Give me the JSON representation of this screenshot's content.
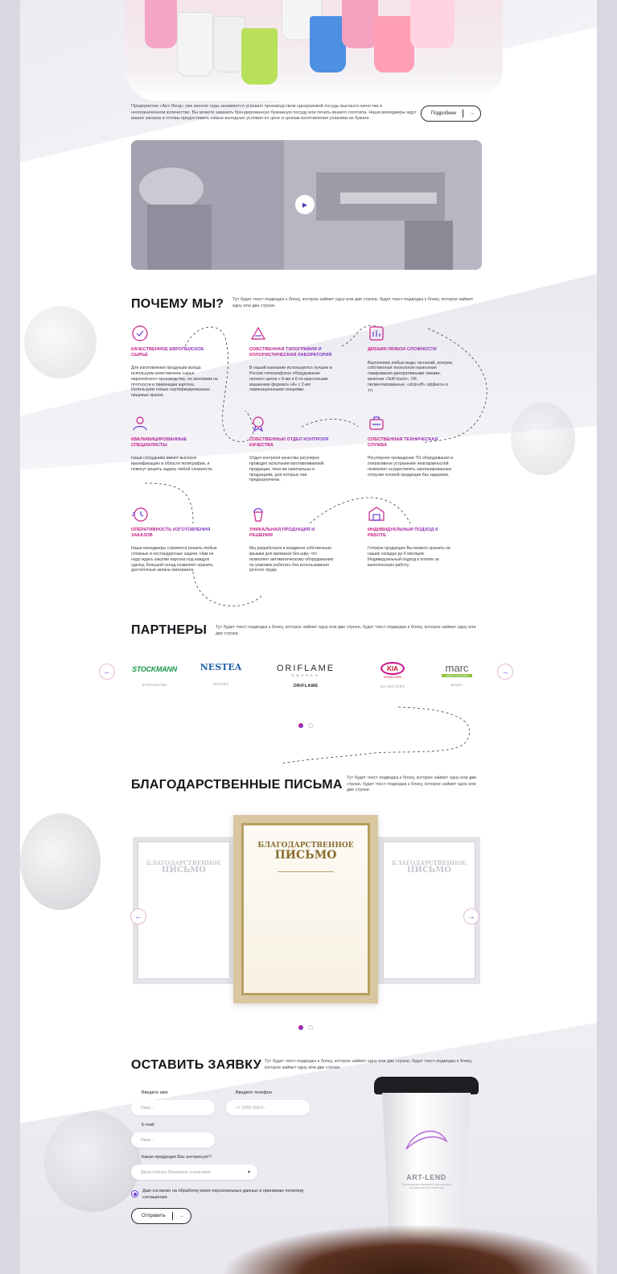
{
  "intro": {
    "text": "Предприятие «Арт-Ленд» уже многие годы занимается успешно производством одноразовой посуды высокого качества в неограниченном количестве. Вы можете заказать брендированную бумажную посуду или печать вашего логотипа. Наши менеджеры ждут ваших заказов и готовы предоставить самые выгодные условия по цене и срокам изготовления упаковки из бумаги",
    "more_label": "Подробнее",
    "arrow": "→"
  },
  "video": {
    "play_icon": "▶"
  },
  "why": {
    "title": "ПОЧЕМУ МЫ?",
    "subtitle": "Тут будет текст-подводка к блоку, которое займет одну или две строки, будет текст-подводка к блоку, которое займет одну или две строки.",
    "features": [
      {
        "icon": "quality-material-icon",
        "title": "КАЧЕСТВЕННОЕ ЕВРОПЕЙСКОЕ СЫРЬЕ",
        "text": "Для изготовления продукции всегда используем качественное сырье европейского производства, не экономим на плотности и ламинации картона. Используем только сертифицированные пищевые краски."
      },
      {
        "icon": "lab-icon",
        "title": "СОБСТВЕННАЯ ТИПОГРАФИЯ И КОЛОРИСТИЧЕСКАЯ ЛАБОРАТОРИЯ",
        "text": "В нашей компании используется лучшее в России типографское оборудование полного цикла с 8-ми и 6-ти красочными машинами формата «А» с 2-мя ламинационными секциями."
      },
      {
        "icon": "design-icon",
        "title": "ДИЗАЙН ЛЮБОЙ СЛОЖНОСТИ",
        "text": "Выполняем любые виды тиснений, конгрев, собственная технология нанесения лакирования декоративными лаками, включая «Soft touch», УФ, пигментированные, «strip-off» эффекты и т.п."
      },
      {
        "icon": "specialists-icon",
        "title": "КВАЛИФИЦИРОВАННЫЕ СПЕЦИАЛИСТЫ",
        "text": "Наши сотрудники имеют высокую квалификацию в области полиграфии, и помогут решить задачу любой сложности."
      },
      {
        "icon": "quality-control-icon",
        "title": "СОБСТВЕННЫЙ ОТДЕЛ КОНТРОЛЯ КАЧЕСТВА",
        "text": "Отдел контроля качества регулярно проводит испытания изготавливаемой продукции, тени же капитальны и продукциям, для которых они предназначены."
      },
      {
        "icon": "tech-service-icon",
        "title": "СОБСТВЕННАЯ ТЕХНИЧЕСКАЯ СЛУЖБА",
        "text": "Регулярное проведение ТО оборудования и оперативное устранение неисправностей позволяет осуществлять запланированные отгрузки готовой продукции без задержек."
      },
      {
        "icon": "timer-icon",
        "title": "ОПЕРАТИВНОСТЬ ИЗГОТОВЛЕНИЯ ЗАКАЗОВ",
        "text": "Наши менеджеры стремятся решить любые сложные и нестандартные задачи. Нам не надо ждать закупки картона под каждую сделку, большой склад позволяет хранить достаточные запасы материала."
      },
      {
        "icon": "ice-cream-icon",
        "title": "УНИКАЛЬНАЯ ПРОДУКЦИЯ И РЕШЕНИЯ",
        "text": "Мы разработали и внедрили собственные крышки для креманок без шва, что позволяет автоматическому оборудованию по упаковке работать без использования ручного труда."
      },
      {
        "icon": "warehouse-icon",
        "title": "ИНДИВИДУАЛЬНЫЙ ПОДХОД К РАБОТЕ",
        "text": "Готовую продукцию Вы можете хранить на наших складах до 6 месяцев. Индивидуальный подход к оплате за выполненную работу."
      }
    ]
  },
  "partners": {
    "title": "ПАРТНЕРЫ",
    "subtitle": "Тут будет текст-подводка к блоку, которое займет одну или две строки, будет текст-подводка к блоку, которое займет одну или две строки.",
    "prev": "←",
    "next": "→",
    "items": [
      {
        "logo": "STOCKMANN",
        "caption": "STOCKMANN",
        "color": "#1a9a4b"
      },
      {
        "logo": "NESTEA",
        "caption": "NESTEA",
        "color": "#1d5fa8"
      },
      {
        "logo": "ORIFLAME",
        "sub": "SWEDEN",
        "caption": "ORIFLAME",
        "color": "#2a2933"
      },
      {
        "logo": "KIA",
        "sub": "KIA MOTORS",
        "caption": "KIA MOTORS",
        "color": "#c8102e"
      },
      {
        "logo": "marc",
        "sub": "HAIR & SKIN CARE",
        "caption": "MARC",
        "color": "#5a5a5a"
      }
    ]
  },
  "letters": {
    "title": "БЛАГОДАРСТВЕННЫЕ ПИСЬМА",
    "subtitle": "Тут будет текст-подводка к блоку, которое займет одну или две строки, будет текст-подводка к блоку, которое займет одну или две строки.",
    "letter_title_1": "БЛАГОДАРСТВЕННОЕ",
    "letter_title_2": "ПИСЬМО",
    "prev": "←",
    "next": "→"
  },
  "request": {
    "title": "ОСТАВИТЬ ЗАЯВКУ",
    "subtitle": "Тут будет текст-подводка к блоку, которое займет одну или две строки, будет текст-подводка к блоку, которое займет одну или две строки.",
    "name_label": "Введите имя",
    "name_placeholder": "Иван...",
    "phone_label": "Введите телефон",
    "phone_placeholder": "+7 (990) 999-9...",
    "email_label": "E-mail",
    "email_placeholder": "Иван...",
    "product_label": "Какая продукция Вас интересует?",
    "product_value": "Двухслойные бумажные стаканчики",
    "product_caret": "▼",
    "consent": "Даю согласие на обработку моих персональных данных и принимаю политику соглашения",
    "submit_label": "Отправить",
    "submit_arrow": "→"
  },
  "cup": {
    "brand": "ART-LEND",
    "tagline": "Производство бумажной одноразовой посуды высокого качества"
  },
  "colors": {
    "accent_purple": "#6a3ad6",
    "accent_pink": "#d2177a"
  }
}
